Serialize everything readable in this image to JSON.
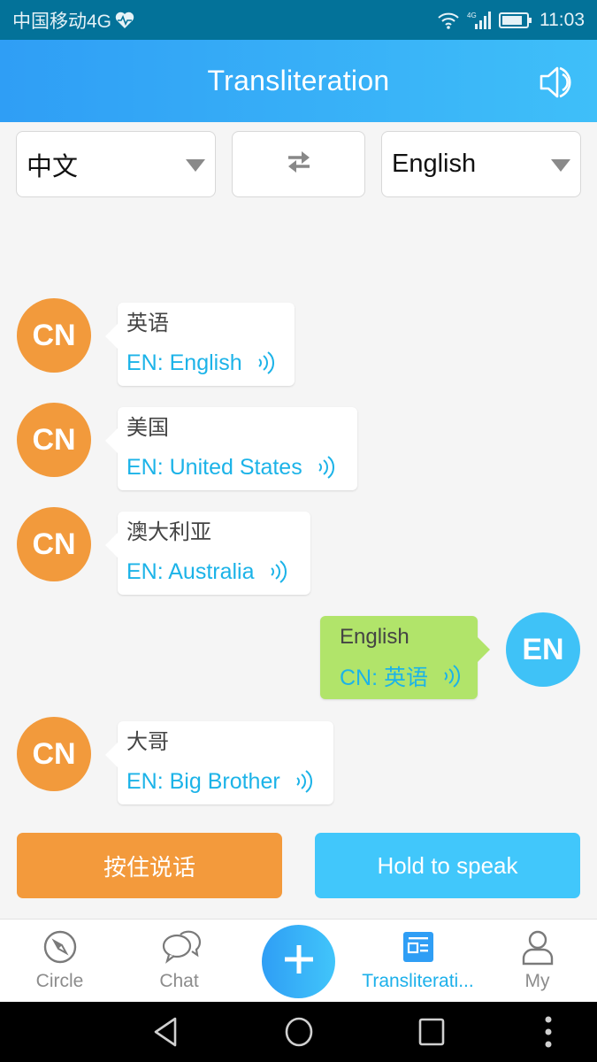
{
  "status_bar": {
    "carrier": "中国移动4G",
    "network": "4G",
    "time": "11:03"
  },
  "app_bar": {
    "title": "Transliteration",
    "speaker_icon": "speaker-icon"
  },
  "language_selector": {
    "source": "中文",
    "target": "English",
    "swap_icon": "swap-arrows-icon"
  },
  "messages": [
    {
      "side": "left",
      "avatar": "CN",
      "text": "英语",
      "translation": "EN: English"
    },
    {
      "side": "left",
      "avatar": "CN",
      "text": "美国",
      "translation": "EN: United States"
    },
    {
      "side": "left",
      "avatar": "CN",
      "text": "澳大利亚",
      "translation": "EN: Australia"
    },
    {
      "side": "right",
      "avatar": "EN",
      "text": "English",
      "translation": "CN: 英语"
    },
    {
      "side": "left",
      "avatar": "CN",
      "text": "大哥",
      "translation": "EN: Big Brother"
    }
  ],
  "speak_buttons": {
    "chinese": "按住说话",
    "english": "Hold to speak"
  },
  "tab_bar": {
    "tabs": [
      {
        "label": "Circle",
        "icon": "compass-icon",
        "active": false
      },
      {
        "label": "Chat",
        "icon": "chat-bubbles-icon",
        "active": false
      },
      {
        "label": "Transliterati...",
        "icon": "transliteration-card-icon",
        "active": true
      },
      {
        "label": "My",
        "icon": "person-icon",
        "active": false
      }
    ],
    "fab_icon": "plus-icon"
  },
  "colors": {
    "status_bar": "#037299",
    "header_start": "#2f9ef5",
    "header_end": "#3fbff9",
    "cn_accent": "#f29a3c",
    "en_accent": "#3fc2f7",
    "sent_bubble": "#b1e46a",
    "translation_text": "#1cb3e8"
  }
}
